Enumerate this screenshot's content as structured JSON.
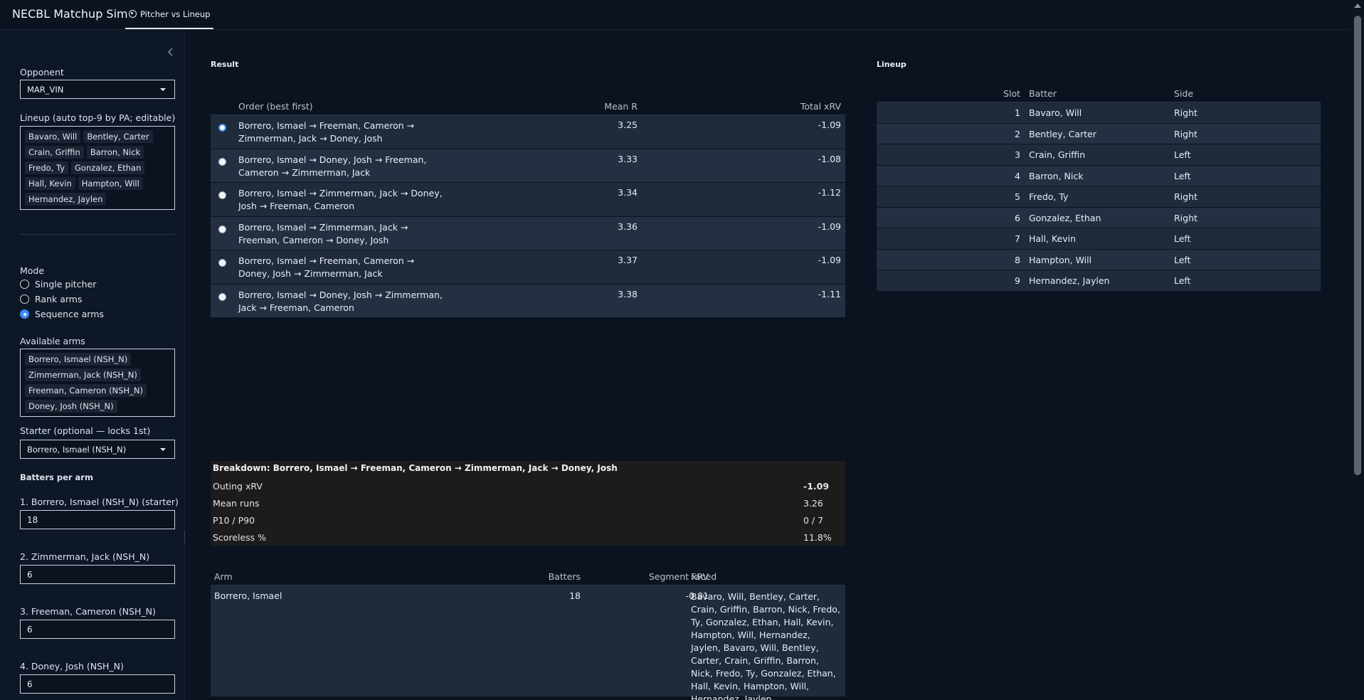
{
  "app": {
    "title": "NECBL Matchup Sim",
    "tab_label": "Pitcher vs Lineup"
  },
  "sidebar": {
    "opponent_label": "Opponent",
    "opponent_value": "MAR_VIN",
    "lineup_label": "Lineup (auto top-9 by PA; editable)",
    "lineup_chips": [
      "Bavaro, Will",
      "Bentley, Carter",
      "Crain, Griffin",
      "Barron, Nick",
      "Fredo, Ty",
      "Gonzalez, Ethan",
      "Hall, Kevin",
      "Hampton, Will",
      "Hernandez, Jaylen"
    ],
    "mode_label": "Mode",
    "mode_options": [
      "Single pitcher",
      "Rank arms",
      "Sequence arms"
    ],
    "mode_selected": 2,
    "arms_label": "Available arms",
    "arms_chips": [
      "Borrero, Ismael (NSH_N)",
      "Zimmerman, Jack (NSH_N)",
      "Freeman, Cameron (NSH_N)",
      "Doney, Josh (NSH_N)"
    ],
    "starter_label": "Starter (optional — locks 1st)",
    "starter_value": "Borrero, Ismael (NSH_N)",
    "bpa_label": "Batters per arm",
    "bpa_inputs": [
      {
        "label": "1. Borrero, Ismael (NSH_N) (starter)",
        "value": "18"
      },
      {
        "label": "2. Zimmerman, Jack (NSH_N)",
        "value": "6"
      },
      {
        "label": "3. Freeman, Cameron (NSH_N)",
        "value": "6"
      },
      {
        "label": "4. Doney, Josh (NSH_N)",
        "value": "6"
      }
    ]
  },
  "result": {
    "title": "Result",
    "headers": {
      "order": "Order (best first)",
      "mean": "Mean R",
      "xrv": "Total xRV"
    },
    "rows": [
      {
        "order": "Borrero, Ismael → Freeman, Cameron → Zimmerman, Jack → Doney, Josh",
        "mean": "3.25",
        "xrv": "-1.09",
        "selected": true
      },
      {
        "order": "Borrero, Ismael → Doney, Josh → Freeman, Cameron → Zimmerman, Jack",
        "mean": "3.33",
        "xrv": "-1.08",
        "selected": false
      },
      {
        "order": "Borrero, Ismael → Zimmerman, Jack → Doney, Josh → Freeman, Cameron",
        "mean": "3.34",
        "xrv": "-1.12",
        "selected": false
      },
      {
        "order": "Borrero, Ismael → Zimmerman, Jack → Freeman, Cameron → Doney, Josh",
        "mean": "3.36",
        "xrv": "-1.09",
        "selected": false
      },
      {
        "order": "Borrero, Ismael → Freeman, Cameron → Doney, Josh → Zimmerman, Jack",
        "mean": "3.37",
        "xrv": "-1.09",
        "selected": false
      },
      {
        "order": "Borrero, Ismael → Doney, Josh → Zimmerman, Jack → Freeman, Cameron",
        "mean": "3.38",
        "xrv": "-1.11",
        "selected": false
      }
    ]
  },
  "lineup": {
    "title": "Lineup",
    "headers": {
      "slot": "Slot",
      "batter": "Batter",
      "side": "Side"
    },
    "rows": [
      {
        "slot": "1",
        "batter": "Bavaro, Will",
        "side": "Right"
      },
      {
        "slot": "2",
        "batter": "Bentley, Carter",
        "side": "Right"
      },
      {
        "slot": "3",
        "batter": "Crain, Griffin",
        "side": "Left"
      },
      {
        "slot": "4",
        "batter": "Barron, Nick",
        "side": "Left"
      },
      {
        "slot": "5",
        "batter": "Fredo, Ty",
        "side": "Right"
      },
      {
        "slot": "6",
        "batter": "Gonzalez, Ethan",
        "side": "Right"
      },
      {
        "slot": "7",
        "batter": "Hall, Kevin",
        "side": "Left"
      },
      {
        "slot": "8",
        "batter": "Hampton, Will",
        "side": "Left"
      },
      {
        "slot": "9",
        "batter": "Hernandez, Jaylen",
        "side": "Left"
      }
    ]
  },
  "breakdown": {
    "title": "Breakdown: Borrero, Ismael → Freeman, Cameron → Zimmerman, Jack → Doney, Josh",
    "rows": [
      {
        "label": "Outing xRV",
        "value": "-1.09"
      },
      {
        "label": "Mean runs",
        "value": "3.26"
      },
      {
        "label": "P10 / P90",
        "value": "0 / 7"
      },
      {
        "label": "Scoreless %",
        "value": "11.8%"
      }
    ]
  },
  "arms": {
    "headers": {
      "arm": "Arm",
      "batters": "Batters",
      "seg": "Segment xRV",
      "faced": "Faced"
    },
    "rows": [
      {
        "arm": "Borrero, Ismael",
        "batters": "18",
        "seg": "-0.81",
        "faced": "Bavaro, Will, Bentley, Carter, Crain, Griffin, Barron, Nick, Fredo, Ty, Gonzalez, Ethan, Hall, Kevin, Hampton, Will, Hernandez, Jaylen, Bavaro, Will, Bentley, Carter, Crain, Griffin, Barron, Nick, Fredo, Ty, Gonzalez, Ethan, Hall, Kevin, Hampton, Will, Hernandez, Jaylen"
      }
    ]
  },
  "colors": {
    "accent": "#3d8bfd",
    "background": "#0b1320",
    "sidebar": "#0e1726",
    "row_odd": "#1f2a3a",
    "row_even": "#243042",
    "breakdown_bg": "#1c1c1c"
  },
  "icons": {
    "collapse": "chevron-left-icon",
    "tab": "target-icon"
  }
}
